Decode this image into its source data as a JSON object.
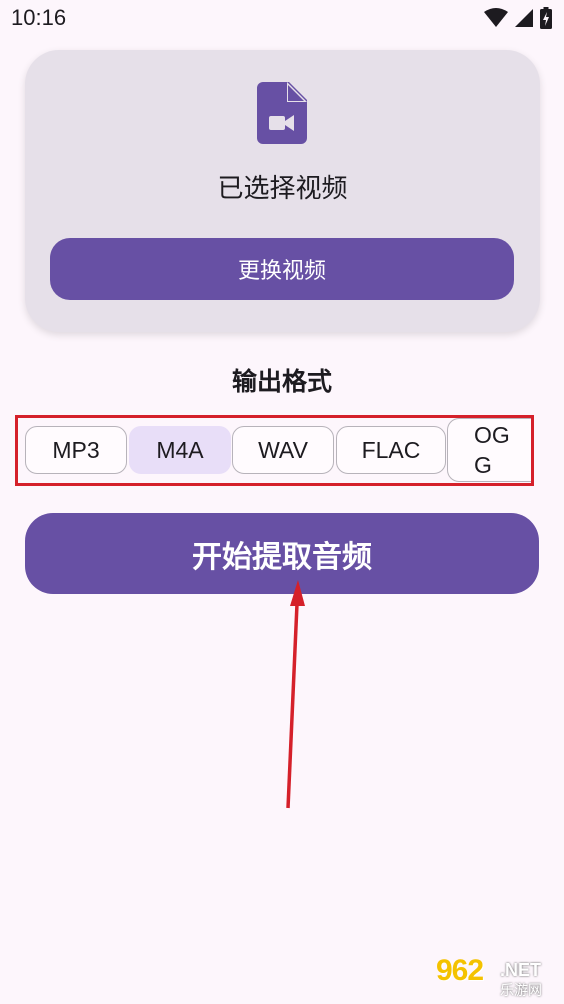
{
  "status_bar": {
    "time": "10:16"
  },
  "video_card": {
    "title": "已选择视频",
    "change_button": "更换视频",
    "icon": "video-file-icon",
    "icon_color": "#6750A4"
  },
  "output_format": {
    "title": "输出格式",
    "options": [
      "MP3",
      "M4A",
      "WAV",
      "FLAC",
      "OGG"
    ],
    "selected": "M4A"
  },
  "start_button": {
    "label": "开始提取音频"
  },
  "watermark": {
    "number": "962",
    "suffix": ".NET",
    "cn": "乐游网"
  },
  "colors": {
    "primary": "#6750A4",
    "card_bg": "#E6E0E9",
    "selected_bg": "#E8DEF8",
    "page_bg": "#FDF6FC",
    "annotation": "#D5202A"
  }
}
